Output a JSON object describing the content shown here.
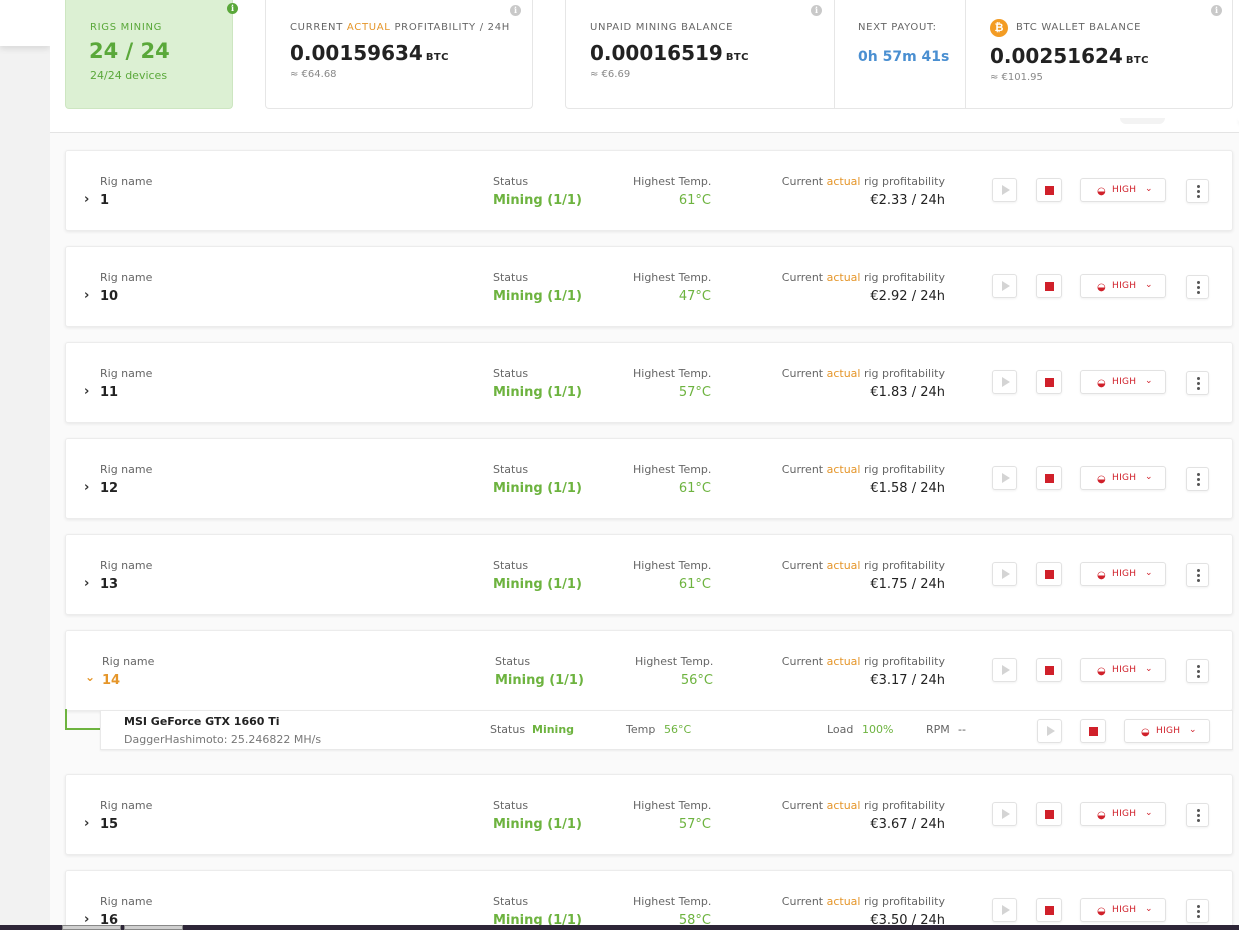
{
  "stats": {
    "rigs_mining": {
      "label": "RIGS MINING",
      "value": "24 / 24",
      "sub": "24/24 devices"
    },
    "profitability": {
      "label_prefix": "CURRENT ",
      "label_accent": "ACTUAL",
      "label_suffix": " PROFITABILITY / 24H",
      "value": "0.00159634",
      "unit": "BTC",
      "fiat": "≈ €64.68"
    },
    "unpaid": {
      "label": "UNPAID MINING BALANCE",
      "value": "0.00016519",
      "unit": "BTC",
      "fiat": "≈ €6.69"
    },
    "next_payout": {
      "label": "NEXT PAYOUT:",
      "value": "0h 57m 41s"
    },
    "wallet": {
      "label": "BTC WALLET BALANCE",
      "value": "0.00251624",
      "unit": "BTC",
      "fiat": "≈ €101.95",
      "coin_glyph": "₿"
    },
    "info_glyph": "i"
  },
  "labels": {
    "rig_name": "Rig name",
    "status": "Status",
    "highest_temp": "Highest Temp.",
    "prof_prefix": "Current ",
    "prof_accent": "actual",
    "prof_suffix": " rig profitability",
    "power": "HIGH"
  },
  "rigs": [
    {
      "name": "1",
      "status": "Mining (1/1)",
      "temp": "61°C",
      "profit": "€2.33 / 24h"
    },
    {
      "name": "10",
      "status": "Mining (1/1)",
      "temp": "47°C",
      "profit": "€2.92 / 24h"
    },
    {
      "name": "11",
      "status": "Mining (1/1)",
      "temp": "57°C",
      "profit": "€1.83 / 24h"
    },
    {
      "name": "12",
      "status": "Mining (1/1)",
      "temp": "61°C",
      "profit": "€1.58 / 24h"
    },
    {
      "name": "13",
      "status": "Mining (1/1)",
      "temp": "61°C",
      "profit": "€1.75 / 24h"
    },
    {
      "name": "14",
      "status": "Mining (1/1)",
      "temp": "56°C",
      "profit": "€3.17 / 24h"
    },
    {
      "name": "15",
      "status": "Mining (1/1)",
      "temp": "57°C",
      "profit": "€3.67 / 24h"
    },
    {
      "name": "16",
      "status": "Mining (1/1)",
      "temp": "58°C",
      "profit": "€3.50 / 24h"
    }
  ],
  "device": {
    "name": "MSI GeForce GTX 1660 Ti",
    "algo": "DaggerHashimoto: 25.246822 MH/s",
    "status_label": "Status",
    "status_value": "Mining",
    "temp_label": "Temp",
    "temp_value": "56°C",
    "load_label": "Load",
    "load_value": "100%",
    "rpm_label": "RPM",
    "rpm_value": "--"
  },
  "glyphs": {
    "chevron_right": "›",
    "chevron_down": "⌄",
    "caret": "⌄",
    "gauge": "◒"
  },
  "colors": {
    "accent_green": "#6db33f",
    "accent_orange": "#e5962a",
    "danger_red": "#d0202a",
    "payout_blue": "#4a8fd1"
  }
}
